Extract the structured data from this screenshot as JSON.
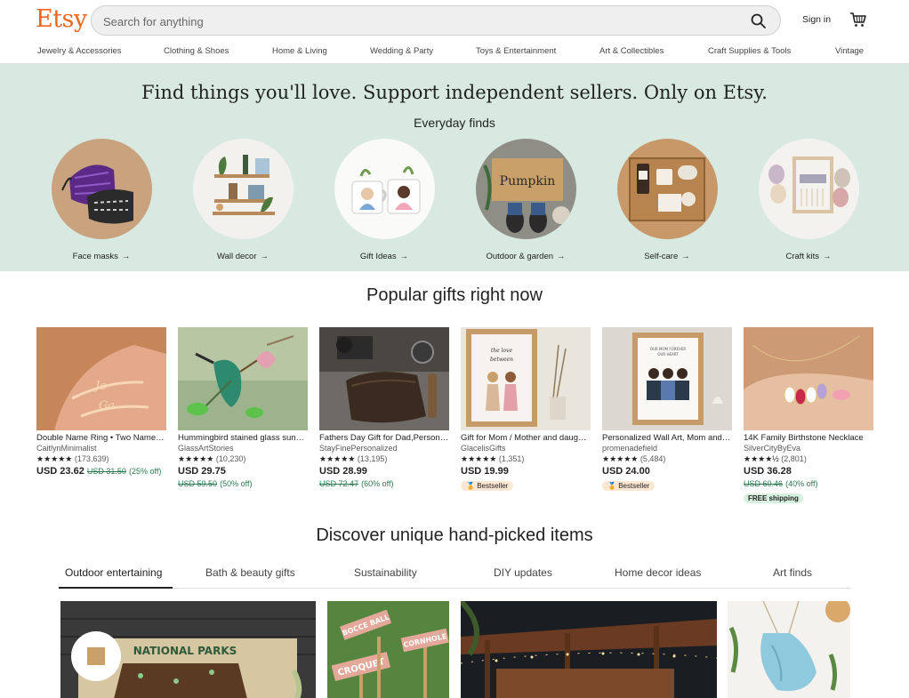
{
  "header": {
    "logo": "Etsy",
    "search_placeholder": "Search for anything",
    "signin": "Sign in"
  },
  "categories": [
    "Jewelry & Accessories",
    "Clothing & Shoes",
    "Home & Living",
    "Wedding & Party",
    "Toys & Entertainment",
    "Art & Collectibles",
    "Craft Supplies & Tools",
    "Vintage"
  ],
  "hero": {
    "title": "Find things you'll love. Support independent sellers. Only on Etsy.",
    "subtitle": "Everyday finds",
    "finds": [
      {
        "label": "Face masks",
        "arrow": "→"
      },
      {
        "label": "Wall decor",
        "arrow": "→"
      },
      {
        "label": "Gift Ideas",
        "arrow": "→"
      },
      {
        "label": "Outdoor & garden",
        "arrow": "→"
      },
      {
        "label": "Self-care",
        "arrow": "→"
      },
      {
        "label": "Craft kits",
        "arrow": "→"
      }
    ]
  },
  "popular": {
    "title": "Popular gifts right now",
    "items": [
      {
        "title": "Double Name Ring • Two Name Ring",
        "shop": "CaitlynMinimalist",
        "stars": "★★★★★",
        "count": "(173,639)",
        "price": "USD 23.62",
        "original": "USD 31.50",
        "discount": "(25% off)",
        "badge": ""
      },
      {
        "title": "Hummingbird stained glass suncatcher",
        "shop": "GlassArtStories",
        "stars": "★★★★★",
        "count": "(10,230)",
        "price": "USD 29.75",
        "original": "USD 59.50",
        "discount": "(50% off)",
        "badge": ""
      },
      {
        "title": "Fathers Day Gift for Dad,Personalized Wallet",
        "shop": "StayFinePersonalized",
        "stars": "★★★★★",
        "count": "(13,195)",
        "price": "USD 28.99",
        "original": "USD 72.47",
        "discount": "(60% off)",
        "badge": ""
      },
      {
        "title": "Gift for Mom / Mother and daughter print",
        "shop": "GlacelisGifts",
        "stars": "★★★★★",
        "count": "(1,351)",
        "price": "USD 19.99",
        "original": "",
        "discount": "",
        "badge": "Bestseller"
      },
      {
        "title": "Personalized Wall Art, Mom and daughters",
        "shop": "promenadefield",
        "stars": "★★★★★",
        "count": "(5,484)",
        "price": "USD 24.00",
        "original": "",
        "discount": "",
        "badge": "Bestseller"
      },
      {
        "title": "14K Family Birthstone Necklace",
        "shop": "SilverCityByEva",
        "stars": "★★★★½",
        "count": "(2,801)",
        "price": "USD 36.28",
        "original": "USD 60.46",
        "discount": "(40% off)",
        "badge": "FREE shipping"
      }
    ]
  },
  "discover": {
    "title": "Discover unique hand-picked items",
    "tabs": [
      "Outdoor entertaining",
      "Bath & beauty gifts",
      "Sustainability",
      "DIY updates",
      "Home decor ideas",
      "Art finds"
    ],
    "active_tab": 0,
    "images": [
      {
        "caption": "NATIONAL PARKS"
      },
      {
        "signs": [
          "BOCCE BALL",
          "CORNHOLE",
          "CROQUET"
        ]
      },
      {},
      {}
    ]
  },
  "colors": {
    "brand": "#F1641E",
    "hero_bg": "#D7E9E0",
    "sale_green": "#2A7A4F"
  }
}
